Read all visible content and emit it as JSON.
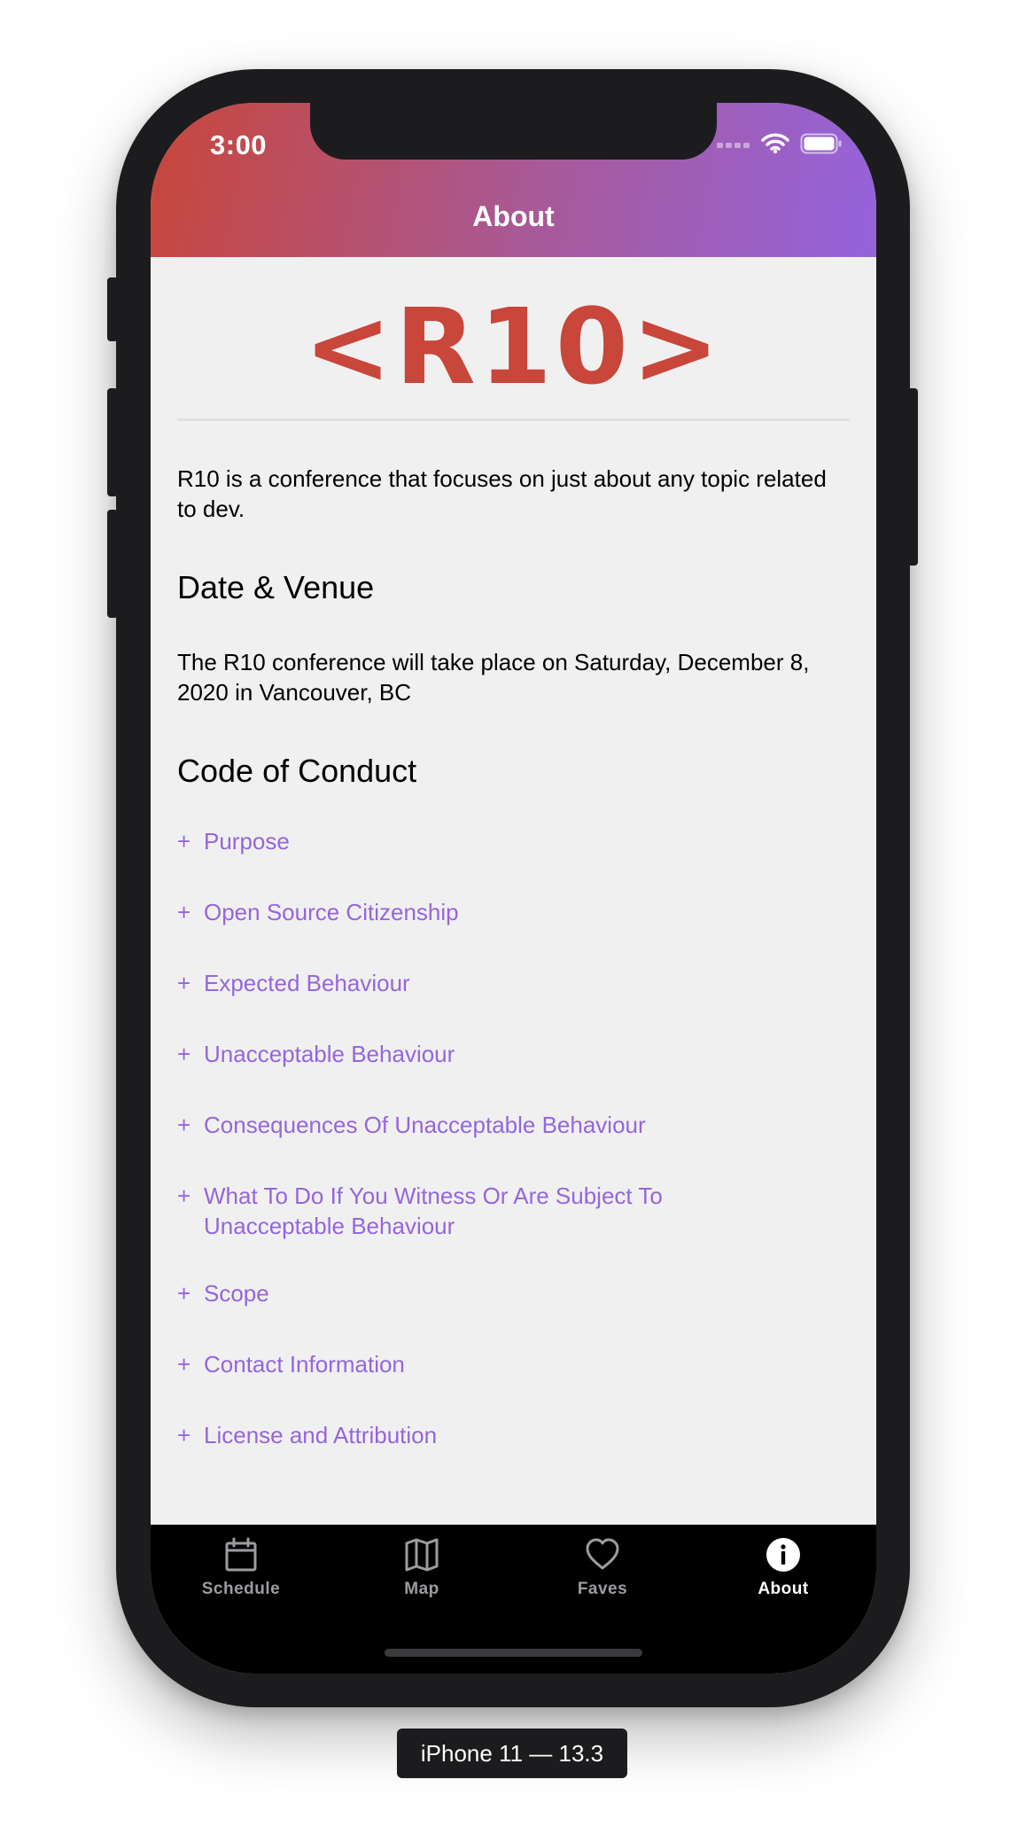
{
  "status": {
    "time": "3:00"
  },
  "header": {
    "title": "About"
  },
  "logo": {
    "text": "<R10>"
  },
  "intro": "R10 is a conference that focuses on just about any topic related to dev.",
  "venue": {
    "title": "Date & Venue",
    "text": "The R10 conference will take place on Saturday, December 8, 2020 in Vancouver, BC"
  },
  "code_of_conduct": {
    "title": "Code of Conduct",
    "items": [
      {
        "label": "Purpose"
      },
      {
        "label": "Open Source Citizenship"
      },
      {
        "label": "Expected Behaviour"
      },
      {
        "label": "Unacceptable Behaviour"
      },
      {
        "label": "Consequences Of Unacceptable Behaviour"
      },
      {
        "label": "What To Do If You Witness Or Are Subject To Unacceptable Behaviour"
      },
      {
        "label": "Scope"
      },
      {
        "label": "Contact Information"
      },
      {
        "label": "License and Attribution"
      }
    ],
    "expand_symbol": "+"
  },
  "tabbar": {
    "tabs": [
      {
        "label": "Schedule",
        "icon": "calendar-icon"
      },
      {
        "label": "Map",
        "icon": "map-icon"
      },
      {
        "label": "Faves",
        "icon": "heart-icon"
      },
      {
        "label": "About",
        "icon": "info-icon"
      }
    ],
    "active": "About"
  },
  "device_label": "iPhone 11 — 13.3",
  "colors": {
    "brand_red": "#c8463a",
    "brand_purple": "#9566dc",
    "background": "#f1f0f1"
  }
}
